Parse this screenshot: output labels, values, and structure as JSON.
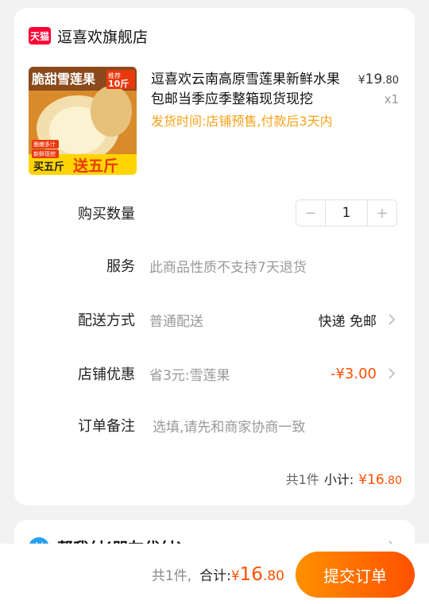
{
  "shop": {
    "badge": "天猫",
    "name": "逗喜欢旗舰店"
  },
  "product": {
    "image_texts": {
      "headline": "脆甜雪莲果",
      "tag_small": "推荐",
      "tag_weight": "10斤",
      "sticker1": "脆嫩多汁",
      "sticker2": "新鲜现挖",
      "promo_a": "买五斤",
      "promo_b": "送五斤"
    },
    "name": "逗喜欢云南高原雪莲果新鲜水果包邮当季应季整箱现货现挖",
    "price_currency": "¥",
    "price_int": "19",
    "price_dec": ".80",
    "quantity_label": "x1",
    "ship_note": "发货时间:店铺预售,付款后3天内"
  },
  "rows": {
    "quantity": {
      "label": "购买数量",
      "value": "1",
      "minus": "−",
      "plus": "+"
    },
    "service": {
      "label": "服务",
      "value": "此商品性质不支持7天退货"
    },
    "delivery": {
      "label": "配送方式",
      "value": "普通配送",
      "right": "快递 免邮"
    },
    "coupon": {
      "label": "店铺优惠",
      "value": "省3元:雪莲果",
      "right": "-¥3.00"
    },
    "note": {
      "label": "订单备注",
      "placeholder": "选填,请先和商家协商一致"
    }
  },
  "subtotal": {
    "count": "共1件",
    "label": "小计:",
    "currency": "¥",
    "int": "16",
    "dec": ".80"
  },
  "pay_for_me": {
    "icon": "付",
    "text": "帮我付(朋友代付)"
  },
  "bottom": {
    "count": "共1件,",
    "label": "合计:",
    "currency": "¥",
    "int": "16",
    "dec": ".80",
    "submit": "提交订单"
  },
  "colors": {
    "accent": "#ff5000",
    "warning": "#f7a21a",
    "tmall": "#ff0036"
  },
  "icons": {
    "chevron": "chevron-right-icon"
  }
}
